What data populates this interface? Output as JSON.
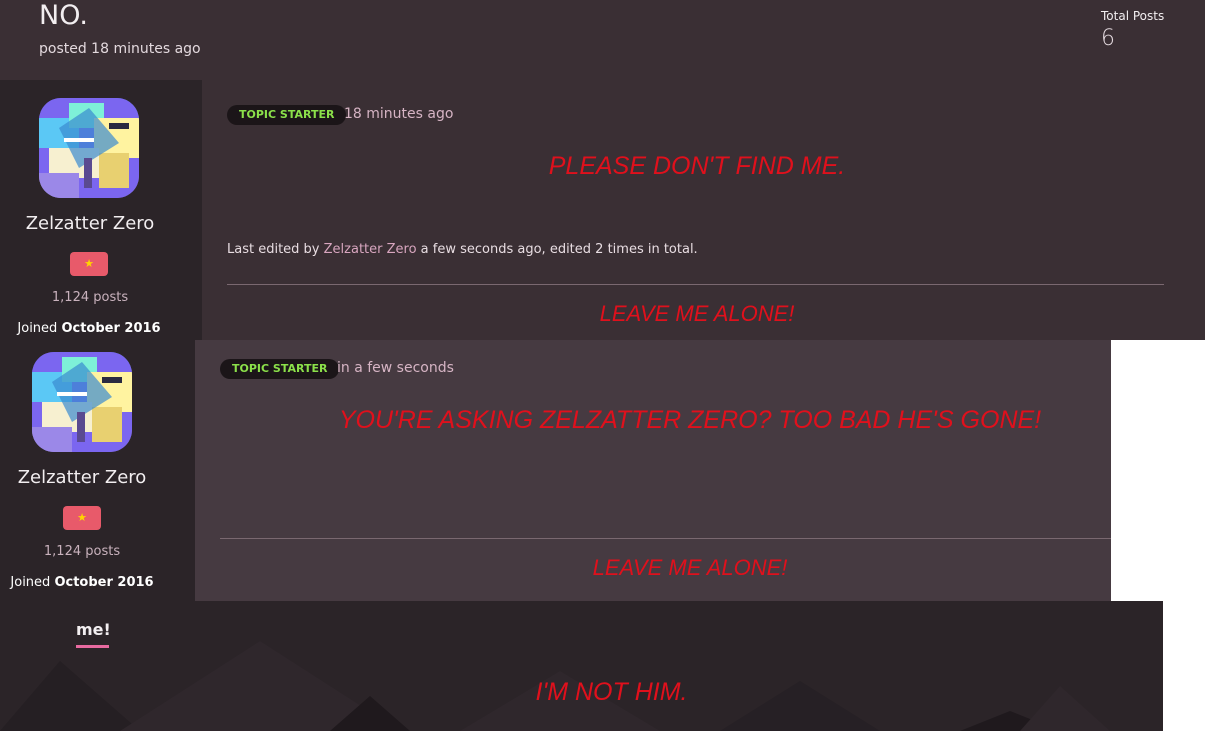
{
  "header": {
    "title": "NO.",
    "posted": "posted 18 minutes ago",
    "total_posts_label": "Total Posts",
    "total_posts_value": "6"
  },
  "posts": [
    {
      "user": {
        "name": "Zelzatter Zero",
        "post_count": "1,124 posts",
        "joined_prefix": "Joined ",
        "joined_date": "October 2016",
        "badge_icon": "star-icon"
      },
      "pill": "TOPIC STARTER",
      "time": "18 minutes ago",
      "message": "PLEASE DON'T FIND ME.",
      "edited_prefix": "Last edited by ",
      "edited_user": "Zelzatter Zero",
      "edited_suffix": " a few seconds ago, edited 2 times in total.",
      "signature": "LEAVE ME ALONE!"
    },
    {
      "user": {
        "name": "Zelzatter Zero",
        "post_count": "1,124 posts",
        "joined_prefix": "Joined ",
        "joined_date": "October 2016",
        "badge_icon": "star-icon"
      },
      "pill": "TOPIC STARTER",
      "time": "in a few seconds",
      "message": "YOU'RE ASKING ZELZATTER ZERO? TOO BAD HE'S GONE!",
      "signature": "LEAVE ME ALONE!"
    }
  ],
  "bottom": {
    "tab_label": "me!",
    "message": "I'M NOT HIM."
  },
  "colors": {
    "accent_pink": "#e86aa0",
    "badge_red": "#e85a6a",
    "message_red": "#e0101c",
    "topic_starter_green": "#8be04a"
  }
}
